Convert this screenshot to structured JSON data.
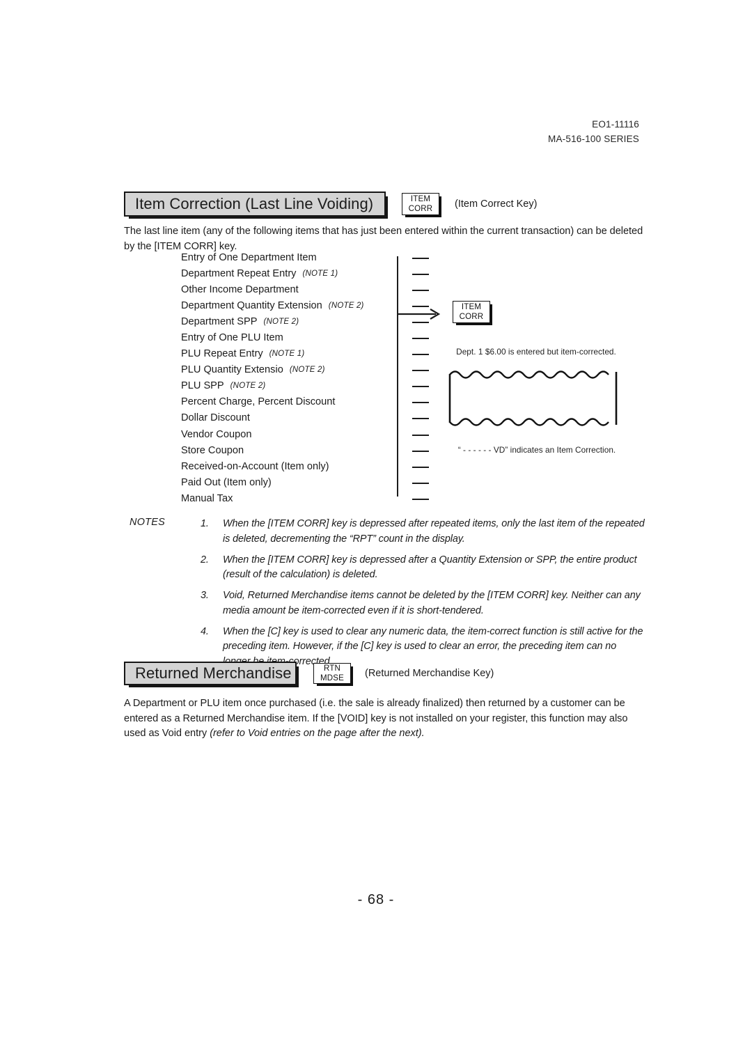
{
  "header": {
    "doc_code": "EO1-11116",
    "series": "MA-516-100 SERIES"
  },
  "item_correction": {
    "title": "Item Correction (Last Line Voiding)",
    "key_line1": "ITEM",
    "key_line2": "CORR",
    "key_caption": "(Item Correct Key)",
    "intro": "The last line item (any of the following items that has just been entered within the current transaction) can be deleted by the [ITEM CORR] key.",
    "list": [
      {
        "label": "Entry of One Department Item",
        "note": ""
      },
      {
        "label": "Department Repeat Entry",
        "note": "(NOTE 1)"
      },
      {
        "label": "Other Income Department",
        "note": ""
      },
      {
        "label": "Department Quantity Extension",
        "note": "(NOTE 2)"
      },
      {
        "label": "Department SPP",
        "note": "(NOTE 2)"
      },
      {
        "label": "Entry of One PLU Item",
        "note": ""
      },
      {
        "label": "PLU Repeat Entry",
        "note": "(NOTE 1)"
      },
      {
        "label": "PLU Quantity Extensio",
        "note": "(NOTE 2)"
      },
      {
        "label": "PLU SPP",
        "note": "(NOTE 2)"
      },
      {
        "label": "Percent Charge, Percent Discount",
        "note": ""
      },
      {
        "label": "Dollar Discount",
        "note": ""
      },
      {
        "label": "Vendor Coupon",
        "note": ""
      },
      {
        "label": "Store Coupon",
        "note": ""
      },
      {
        "label": "Received-on-Account (Item only)",
        "note": ""
      },
      {
        "label": "Paid Out (Item only)",
        "note": ""
      },
      {
        "label": "Manual Tax",
        "note": ""
      }
    ],
    "target_key_line1": "ITEM",
    "target_key_line2": "CORR",
    "receipt_caption_top": "Dept. 1 $6.00  is entered but item-corrected.",
    "receipt_caption_bottom": "“ - -   - -   - - VD” indicates an Item Correction."
  },
  "notes": {
    "label": "NOTES",
    "items": [
      {
        "num": "1.",
        "text": "When the [ITEM CORR] key is depressed after repeated items, only the last item of the repeated is deleted, decrementing the “RPT” count in the display."
      },
      {
        "num": "2.",
        "text": "When the [ITEM CORR] key is depressed after a Quantity Extension or SPP, the entire product (result of the calculation) is deleted."
      },
      {
        "num": "3.",
        "text": "Void, Returned Merchandise items cannot be deleted by the [ITEM CORR] key. Neither can any media amount be item-corrected even if it is short-tendered."
      },
      {
        "num": "4.",
        "text": "When the [C] key is used to clear any numeric data, the item-correct function is still active for the preceding item. However, if the [C] key is used to clear an error, the preceding item can no longer be item-corrected."
      }
    ]
  },
  "returned_merchandise": {
    "title": "Returned Merchandise",
    "key_line1": "RTN",
    "key_line2": "MDSE",
    "key_caption": "(Returned Merchandise Key)",
    "body_plain": "A Department or PLU item once purchased (i.e. the sale is already finalized) then returned by a customer can be entered as a Returned Merchandise item. If the [VOID] key is not installed on your register, this function may also used as Void entry ",
    "body_italic": "(refer to Void  entries on the page after the next)."
  },
  "footer": {
    "page_number": "- 68 -"
  },
  "colors": {
    "ink": "#1b1b1b",
    "title_bar_fill": "#d4d4d4",
    "rule": "#161616"
  }
}
